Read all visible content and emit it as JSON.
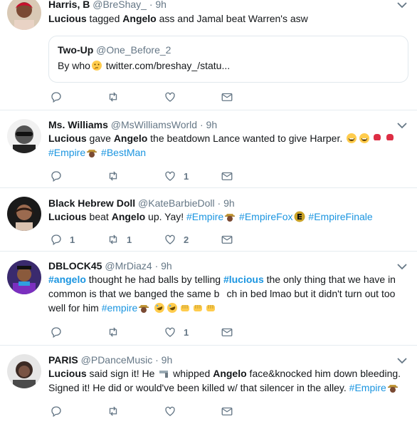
{
  "tweets": [
    {
      "name": "Harris, B",
      "handle": "@BreShay_",
      "time": "· 9h",
      "text": {
        "a": "Lucious",
        "b": " tagged ",
        "c": "Angelo",
        "d": " ass and Jamal beat Warren's asw"
      },
      "quote": {
        "name": "Two-Up",
        "handle": "@One_Before_2",
        "text_a": "By who",
        "text_b": " twitter.com/breshay_/statu..."
      },
      "counts": {
        "reply": "",
        "retweet": "",
        "like": ""
      }
    },
    {
      "name": "Ms. Williams",
      "handle": "@MsWilliamsWorld",
      "time": "· 9h",
      "text": {
        "a": "Lucious",
        "b": " gave ",
        "c": "Angelo",
        "d": " the beatdown Lance wanted to give Harper.",
        "tag1": "#Empire",
        "tag2": "#BestMan"
      },
      "counts": {
        "reply": "",
        "retweet": "",
        "like": "1"
      }
    },
    {
      "name": "Black Hebrew Doll",
      "handle": "@KateBarbieDoll",
      "time": "· 9h",
      "text": {
        "a": "Lucious",
        "b": " beat ",
        "c": "Angelo",
        "d": " up. Yay! ",
        "tag1": "#Empire",
        "tag2": "#EmpireFox",
        "tag3": "#EmpireFinale"
      },
      "counts": {
        "reply": "1",
        "retweet": "1",
        "like": "2"
      }
    },
    {
      "name": "DBLOCK45",
      "handle": "@MrDiaz4",
      "time": "· 9h",
      "text": {
        "tag1": "#angelo",
        "b": " thought he had balls by telling ",
        "tag2": "#lucious",
        "d": " the only thing that we have in common is that we banged the same b",
        "e": "ch in bed lmao but it didn't turn out too well for him ",
        "tag3": "#empire"
      },
      "counts": {
        "reply": "",
        "retweet": "",
        "like": "1"
      }
    },
    {
      "name": "PARIS",
      "handle": "@PDanceMusic",
      "time": "· 9h",
      "text": {
        "a": "Lucious",
        "b": " said sign it! He ",
        "c": " whipped ",
        "d": "Angelo",
        "e": " face&knocked him down bleeding. Signed it! He did or would've been killed w/ that silencer in the alley. ",
        "tag1": "#Empire"
      },
      "counts": {
        "reply": "",
        "retweet": "",
        "like": ""
      }
    }
  ],
  "colors": {
    "link": "#1b95e0",
    "meta": "#657786",
    "text": "#14171a",
    "border": "#e6ecf0"
  },
  "icons": [
    "reply-icon",
    "retweet-icon",
    "like-icon",
    "dm-icon",
    "chevron-down-icon"
  ]
}
